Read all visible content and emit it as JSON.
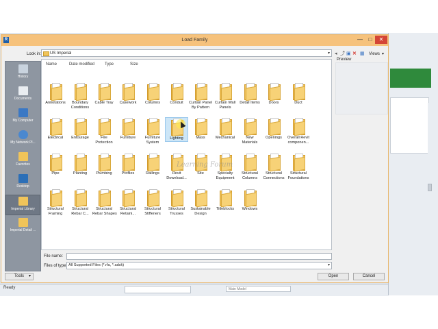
{
  "dialog": {
    "title": "Load Family",
    "app_icon": "R",
    "window_buttons": {
      "minimize": "—",
      "maximize": "□",
      "close": "✕"
    }
  },
  "lookin": {
    "label": "Look in:",
    "value": "US Imperial",
    "dropdown_icon": "chevron-down-icon"
  },
  "toolbar": {
    "icons": [
      "back-icon",
      "up-folder-icon",
      "delete-icon",
      "new-folder-icon"
    ],
    "views_label": "Views"
  },
  "preview": {
    "label": "Preview"
  },
  "places": [
    {
      "label": "History",
      "icon": "history-icon",
      "color": "#c9d3de"
    },
    {
      "label": "Documents",
      "icon": "documents-icon",
      "color": "#e9edf1"
    },
    {
      "label": "My Computer",
      "icon": "computer-icon",
      "color": "#3b78c4"
    },
    {
      "label": "My Network Pl...",
      "icon": "network-icon",
      "color": "#4a88d0"
    },
    {
      "label": "Favorites",
      "icon": "favorites-icon",
      "color": "#f0c45a"
    },
    {
      "label": "Desktop",
      "icon": "desktop-icon",
      "color": "#2c6fb7"
    },
    {
      "label": "Imperial Library",
      "icon": "folder-icon",
      "color": "#f0c45a"
    },
    {
      "label": "Imperial Detail ...",
      "icon": "folder-icon",
      "color": "#f0c45a"
    }
  ],
  "columns": [
    "Name",
    "Date modified",
    "Type",
    "Size"
  ],
  "folders": [
    [
      "Annotations"
    ],
    [
      "Boundary",
      "Conditions"
    ],
    [
      "Cable Tray"
    ],
    [
      "Casework"
    ],
    [
      "Columns"
    ],
    [
      "Conduit"
    ],
    [
      "Curtain Panel",
      "By Pattern"
    ],
    [
      "Curtain Wall",
      "Panels"
    ],
    [
      "Detail Items"
    ],
    [
      "Doors"
    ],
    [
      "Duct"
    ],
    [
      "Electrical"
    ],
    [
      "Entourage"
    ],
    [
      "Fire",
      "Protection"
    ],
    [
      "Furniture"
    ],
    [
      "Furniture",
      "System"
    ],
    [
      "Lighting"
    ],
    [
      "Mass"
    ],
    [
      "Mechanical"
    ],
    [
      "New",
      "Materials"
    ],
    [
      "Openings"
    ],
    [
      "Overall Revit",
      "componen..."
    ],
    [
      "Pipe"
    ],
    [
      "Planting"
    ],
    [
      "Plumbing"
    ],
    [
      "Profiles"
    ],
    [
      "Railings"
    ],
    [
      "Revit",
      "Download..."
    ],
    [
      "Site"
    ],
    [
      "Specialty",
      "Equipment"
    ],
    [
      "Structural",
      "Columns"
    ],
    [
      "Structural",
      "Connections"
    ],
    [
      "Structural",
      "Foundations"
    ],
    [
      "Structural",
      "Framing"
    ],
    [
      "Structural",
      "Rebar C..."
    ],
    [
      "Structural",
      "Rebar Shapes"
    ],
    [
      "Structural",
      "Retaini..."
    ],
    [
      "Structural",
      "Stiffeners"
    ],
    [
      "Structural",
      "Trusses"
    ],
    [
      "Sustainable",
      "Design"
    ],
    [
      "Titleblocks"
    ],
    [
      "Windows"
    ]
  ],
  "selected_folder_index": 16,
  "watermark": "Learning Forum",
  "filename": {
    "label": "File name:",
    "value": ""
  },
  "filetype": {
    "label": "Files of type:",
    "value": "All Supported Files  (*.rfa, *.adsk)"
  },
  "buttons": {
    "tools": "Tools",
    "open": "Open",
    "cancel": "Cancel"
  },
  "statusbar": {
    "text": "Ready",
    "model": "Main Model"
  },
  "colors": {
    "titlebar": "#f6c27c",
    "folder": "#f2c35a",
    "places_panel": "#8e96a1",
    "selection": "#cde6f7"
  }
}
